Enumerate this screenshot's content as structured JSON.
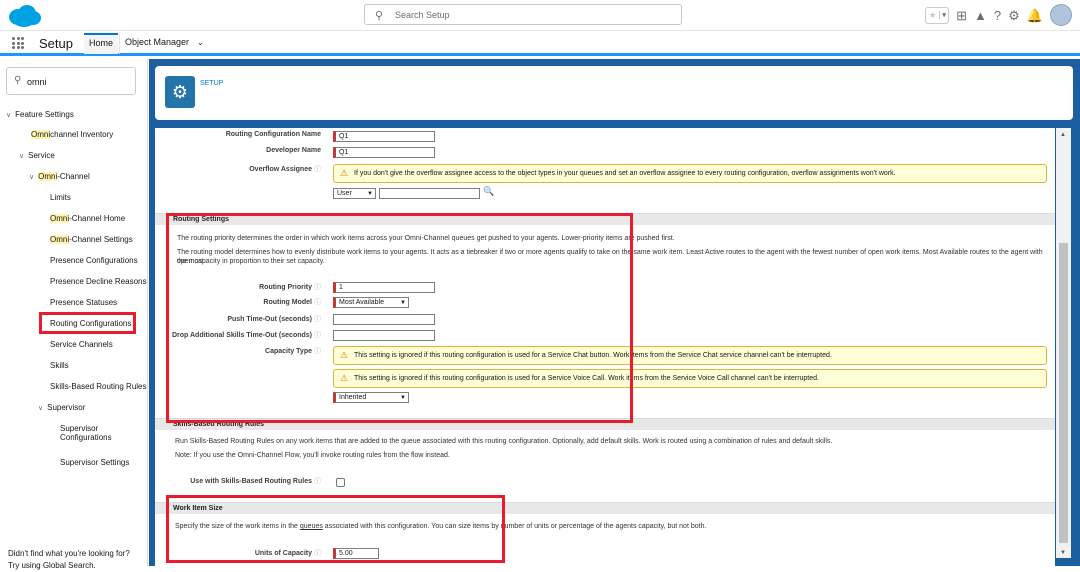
{
  "topbar": {
    "search_placeholder": "Search Setup",
    "icons": [
      "star-icon",
      "chevron-down-icon",
      "add-icon",
      "trailhead-icon",
      "help-icon",
      "gear-icon",
      "bell-icon",
      "avatar"
    ]
  },
  "nav": {
    "app_title": "Setup",
    "tabs": [
      {
        "label": "Home"
      },
      {
        "label": "Object Manager"
      }
    ]
  },
  "sidebar": {
    "quickfind_value": "omni",
    "items": [
      {
        "label": "Feature Settings"
      },
      {
        "label_hl": "Omni",
        "label_rest": "channel Inventory"
      },
      {
        "label": "Service"
      },
      {
        "label_hl": "Omni",
        "label_rest": "-Channel"
      },
      {
        "label": "Limits"
      },
      {
        "label_hl": "Omni",
        "label_rest": "-Channel Home"
      },
      {
        "label_hl": "Omni",
        "label_rest": "-Channel Settings"
      },
      {
        "label": "Presence Configurations"
      },
      {
        "label": "Presence Decline Reasons"
      },
      {
        "label": "Presence Statuses"
      },
      {
        "label": "Routing Configurations"
      },
      {
        "label": "Service Channels"
      },
      {
        "label": "Skills"
      },
      {
        "label": "Skills-Based Routing Rules"
      },
      {
        "label": "Supervisor"
      },
      {
        "label": "Supervisor"
      },
      {
        "label": "Configurations"
      },
      {
        "label": "Supervisor Settings"
      }
    ],
    "help_line1": "Didn't find what you're looking for?",
    "help_line2": "Try using Global Search."
  },
  "header": {
    "setup_label": "SETUP"
  },
  "form": {
    "routing_config_name_label": "Routing Configuration Name",
    "routing_config_name_value": "Q1",
    "developer_name_label": "Developer Name",
    "developer_name_value": "Q1",
    "overflow_label": "Overflow Assignee",
    "overflow_warning": "If you don't give the overflow assignee access to the object types in your queues and set an overflow assignee to every routing configuration, overflow assignments won't work.",
    "overflow_select": "User",
    "routing_settings_heading": "Routing Settings",
    "routing_settings_p1": "The routing priority determines the order in which work items across your Omni-Channel queues get pushed to your agents. Lower-priority items are pushed first.",
    "routing_settings_p2": "The routing model determines how to evenly distribute work items to your agents. It acts as a tiebreaker if two or more agents qualify to take on the same work item. Least Active routes to the agent with the fewest number of open work items. Most Available routes to the agent with the most",
    "routing_settings_p3": "open capacity in proportion to their set capacity.",
    "routing_priority_label": "Routing Priority",
    "routing_priority_value": "1",
    "routing_model_label": "Routing Model",
    "routing_model_value": "Most Available",
    "push_timeout_label": "Push Time-Out (seconds)",
    "drop_skills_label": "Drop Additional Skills Time-Out (seconds)",
    "capacity_type_label": "Capacity Type",
    "capacity_warn1": "This setting is ignored if this routing configuration is used for a Service Chat button. Work items from the Service Chat service channel can't be interrupted.",
    "capacity_warn2": "This setting is ignored if this routing configuration is used for a Service Voice Call. Work items from the Service Voice Call channel can't be interrupted.",
    "capacity_type_value": "Inherited",
    "skills_heading": "Skills-Based Routing Rules",
    "skills_p1": "Run Skills-Based Routing Rules on any work items that are added to the queue associated with this routing configuration. Optionally, add default skills. Work is routed using a combination of rules and default skills.",
    "skills_p2": "Note: If you use the Omni-Channel Flow, you'll invoke routing rules from the flow instead.",
    "use_skills_label": "Use with Skills-Based Routing Rules",
    "work_item_heading": "Work Item Size",
    "work_item_p_pre": "Specify the size of the work items in the ",
    "work_item_p_link": "queues",
    "work_item_p_post": " associated with this configuration. You can size items by number of units or percentage of the agents capacity, but not both.",
    "units_label": "Units of Capacity",
    "units_value": "5.00"
  }
}
